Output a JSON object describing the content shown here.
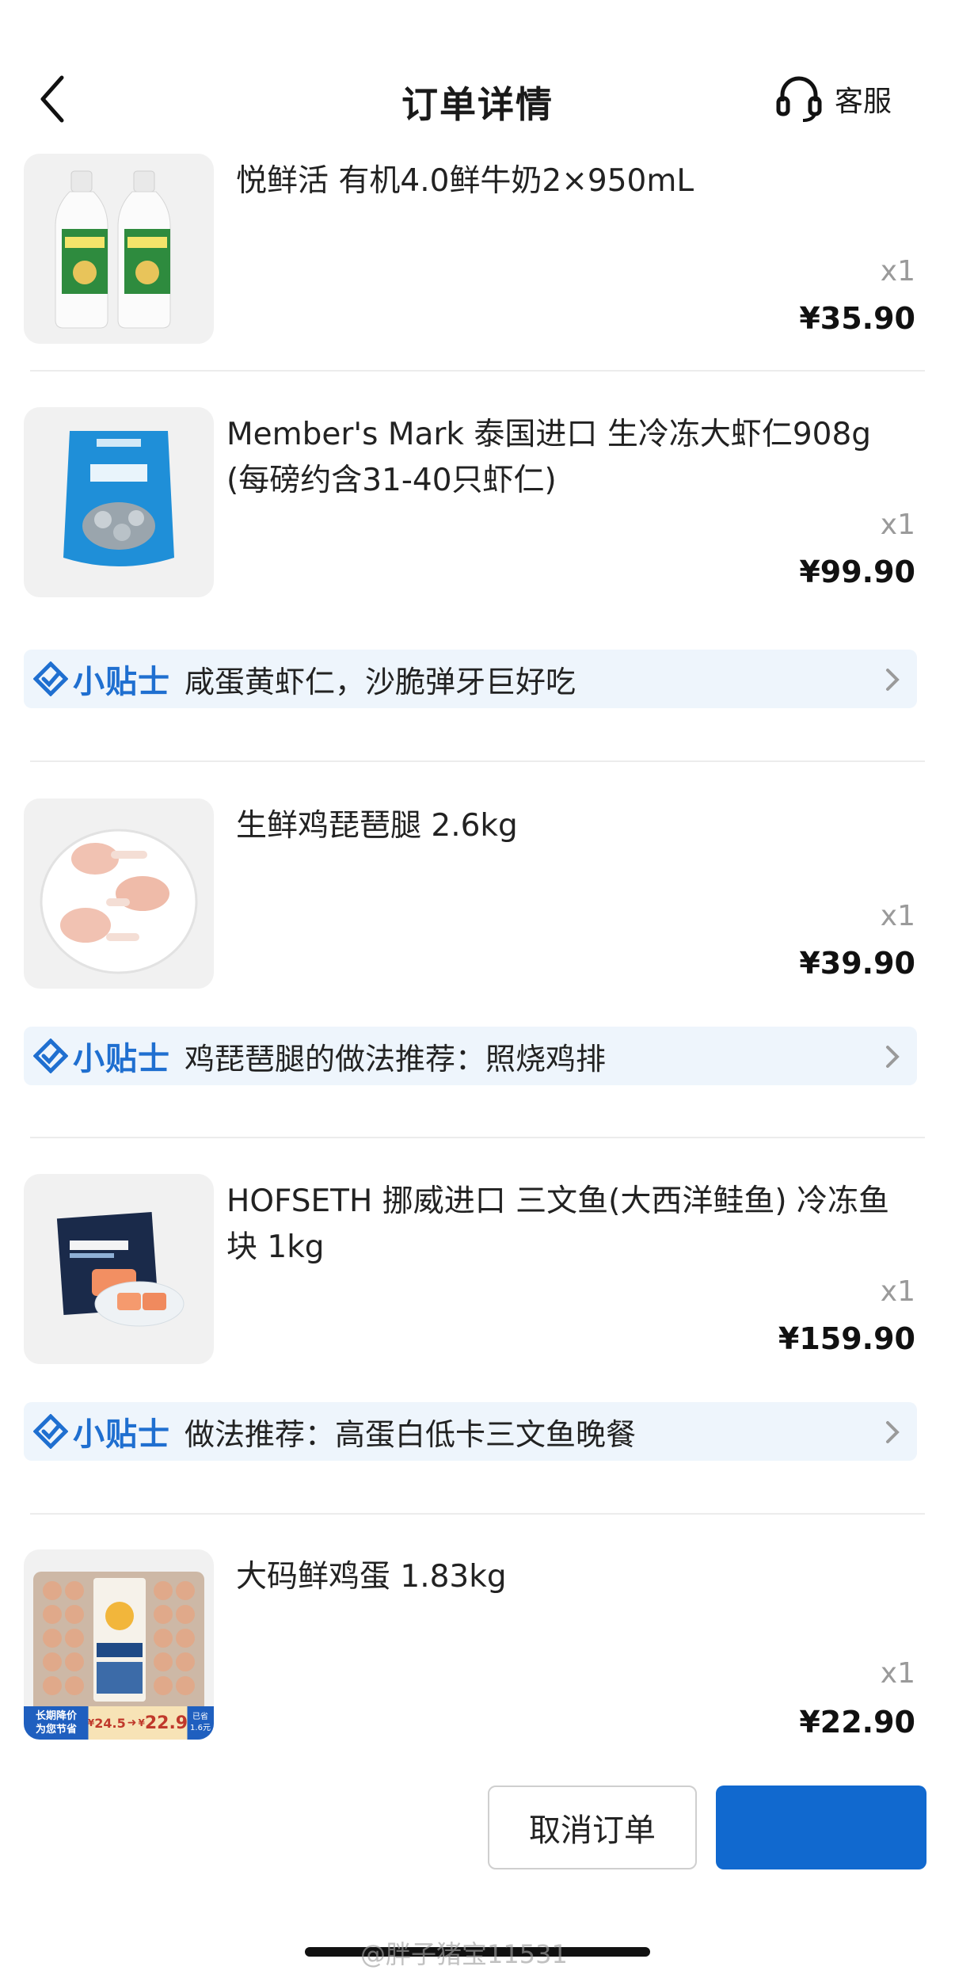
{
  "header": {
    "title": "订单详情",
    "customer_service": "客服"
  },
  "items": [
    {
      "name": "悦鲜活 有机4.0鲜牛奶2×950mL",
      "qty": "x1",
      "price": "¥35.90",
      "image": "milk-bottles"
    },
    {
      "name": " Member's Mark 泰国进口 生冷冻大虾仁908g (每磅约含31-40只虾仁)",
      "qty": "x1",
      "price": "¥99.90",
      "image": "frozen-shrimp-bag",
      "tip": {
        "title": "小贴士",
        "text": "咸蛋黄虾仁，沙脆弹牙巨好吃"
      }
    },
    {
      "name": "生鲜鸡琵琶腿 2.6kg",
      "qty": "x1",
      "price": "¥39.90",
      "image": "chicken-drumsticks",
      "tip": {
        "title": "小贴士",
        "text": "鸡琵琶腿的做法推荐：照烧鸡排"
      }
    },
    {
      "name": " HOFSETH 挪威进口 三文鱼(大西洋鲑鱼) 冷冻鱼块 1kg",
      "qty": "x1",
      "price": "¥159.90",
      "image": "salmon-package",
      "tip": {
        "title": "小贴士",
        "text": "做法推荐：高蛋白低卡三文鱼晚餐"
      }
    },
    {
      "name": "大码鲜鸡蛋 1.83kg",
      "qty": "x1",
      "price": "¥22.90",
      "image": "egg-tray",
      "promo": {
        "line1": "长期降价",
        "line2": "为您节省",
        "old_price": "24.5",
        "new_price": "22.9",
        "saved_line1": "已省",
        "saved_line2": "1.6元"
      }
    }
  ],
  "actions": {
    "cancel": "取消订单",
    "primary": ""
  },
  "watermark": "@胖子猪宝11531",
  "colors": {
    "accent": "#1169cf",
    "tip_bg": "#eef5fc",
    "tip_title": "#1f6fd0"
  }
}
